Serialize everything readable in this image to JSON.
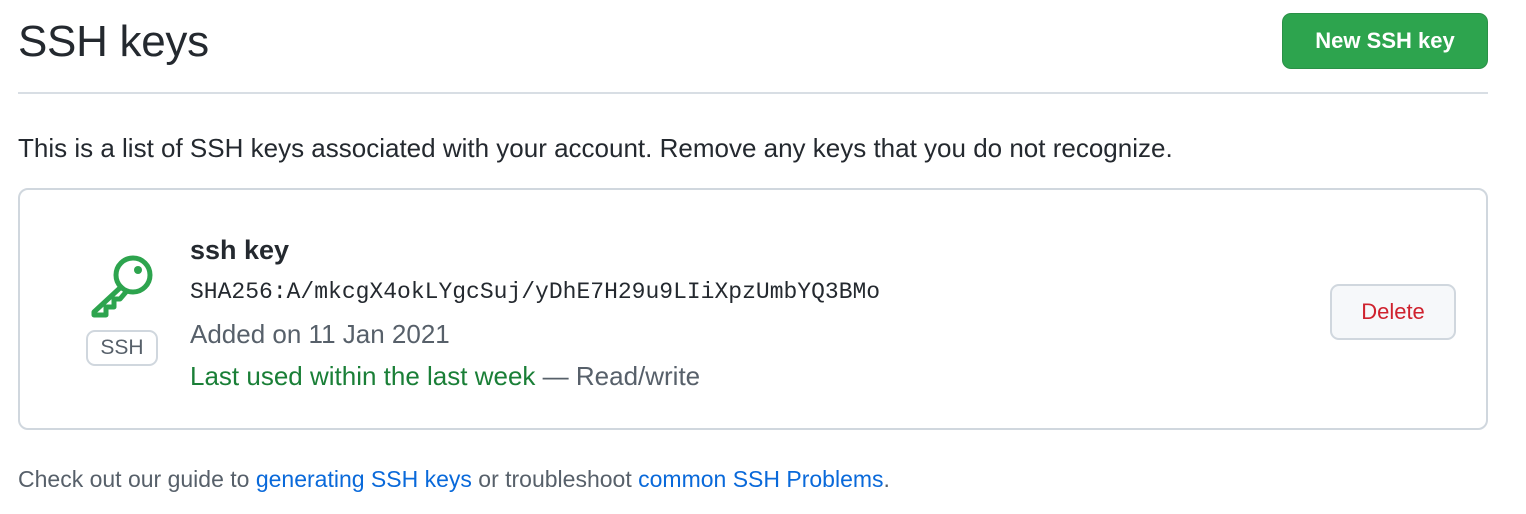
{
  "header": {
    "title": "SSH keys",
    "new_key_label": "New SSH key"
  },
  "intro": "This is a list of SSH keys associated with your account. Remove any keys that you do not recognize.",
  "keys": [
    {
      "icon": "key-icon",
      "type_label": "SSH",
      "title": "ssh key",
      "fingerprint": "SHA256:A/mkcgX4okLYgcSuj/yDhE7H29u9LIiXpzUmbYQ3BMo",
      "added": "Added on 11 Jan 2021",
      "last_used": "Last used within the last week",
      "access": " — Read/write",
      "delete_label": "Delete"
    }
  ],
  "footer": {
    "prefix": "Check out our guide to ",
    "link1": "generating SSH keys",
    "middle": " or troubleshoot ",
    "link2": "common SSH Problems",
    "suffix": "."
  },
  "colors": {
    "primary_button": "#2da44e",
    "success_text": "#1a7f37",
    "danger_text": "#cf222e",
    "link": "#0969da"
  }
}
